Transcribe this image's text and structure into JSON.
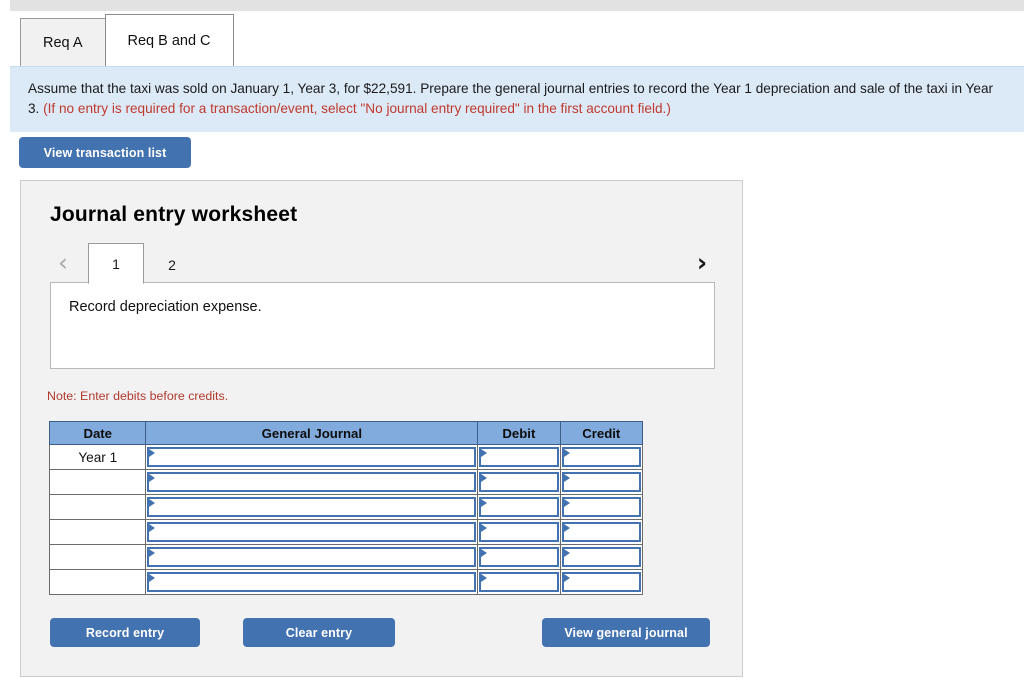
{
  "requirement_tabs": [
    {
      "label": "Req A",
      "active": false
    },
    {
      "label": "Req B and C",
      "active": true
    }
  ],
  "instruction": {
    "main": "Assume that the taxi was sold on January 1, Year 3, for $22,591. Prepare the general journal entries to record the Year 1 depreciation and sale of the taxi in Year 3.",
    "warning": "(If no entry is required for a transaction/event, select \"No journal entry required\" in the first account field.)"
  },
  "toolbar": {
    "view_transaction_list": "View transaction list"
  },
  "worksheet": {
    "title": "Journal entry worksheet",
    "pager": {
      "prev_icon": "chevron-left-icon",
      "next_icon": "chevron-right-icon",
      "prev_glyph": "‹",
      "next_glyph": "›",
      "pages": [
        {
          "label": "1",
          "active": true
        },
        {
          "label": "2",
          "active": false
        }
      ]
    },
    "description": "Record depreciation expense.",
    "note": "Note: Enter debits before credits.",
    "table": {
      "columns": [
        "Date",
        "General Journal",
        "Debit",
        "Credit"
      ],
      "rows": [
        {
          "date": "Year 1",
          "general_journal": "",
          "debit": "",
          "credit": ""
        },
        {
          "date": "",
          "general_journal": "",
          "debit": "",
          "credit": ""
        },
        {
          "date": "",
          "general_journal": "",
          "debit": "",
          "credit": ""
        },
        {
          "date": "",
          "general_journal": "",
          "debit": "",
          "credit": ""
        },
        {
          "date": "",
          "general_journal": "",
          "debit": "",
          "credit": ""
        },
        {
          "date": "",
          "general_journal": "",
          "debit": "",
          "credit": ""
        }
      ]
    },
    "actions": {
      "record_entry": "Record entry",
      "clear_entry": "Clear entry",
      "view_general_journal": "View general journal"
    }
  },
  "colors": {
    "button_blue": "#4272b0",
    "table_header_blue": "#82abdd",
    "instruction_bg": "#dceaf8",
    "warning_red": "#c0392b",
    "note_red": "#b03a2e",
    "panel_bg": "#f2f2f2"
  }
}
